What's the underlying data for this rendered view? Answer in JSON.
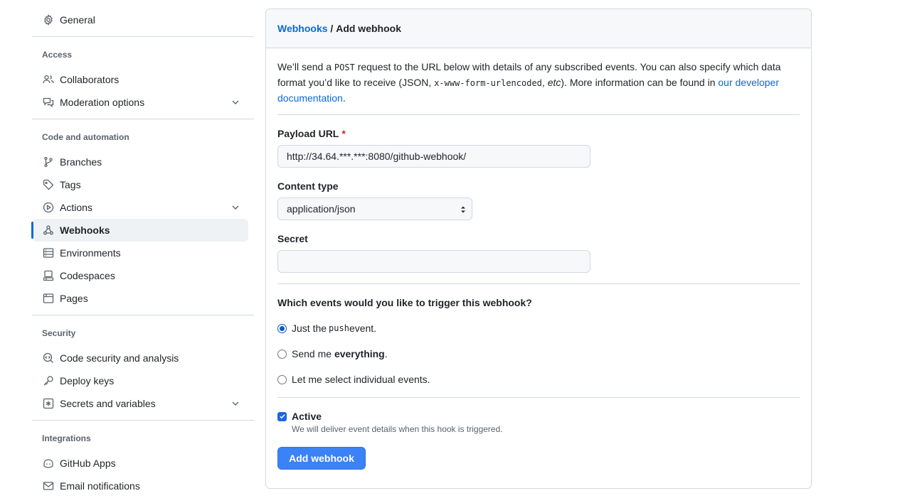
{
  "sidebar": {
    "general": "General",
    "groups": {
      "access": "Access",
      "code_automation": "Code and automation",
      "security": "Security",
      "integrations": "Integrations"
    },
    "items": {
      "collaborators": "Collaborators",
      "moderation": "Moderation options",
      "branches": "Branches",
      "tags": "Tags",
      "actions": "Actions",
      "webhooks": "Webhooks",
      "environments": "Environments",
      "codespaces": "Codespaces",
      "pages": "Pages",
      "code_security": "Code security and analysis",
      "deploy_keys": "Deploy keys",
      "secrets": "Secrets and variables",
      "github_apps": "GitHub Apps",
      "email_notifications": "Email notifications"
    },
    "active_item": "webhooks"
  },
  "breadcrumb": {
    "parent": "Webhooks",
    "separator": " / ",
    "current": "Add webhook"
  },
  "intro": {
    "t1": "We’ll send a ",
    "code1": "POST",
    "t2": " request to the URL below with details of any subscribed events. You can also specify which data format you’d like to receive (JSON, ",
    "code2": "x-www-form-urlencoded",
    "t3": ", ",
    "etc": "etc",
    "t4": "). More information can be found in ",
    "link": "our developer documentation",
    "t5": "."
  },
  "form": {
    "payload_label": "Payload URL",
    "payload_required": "*",
    "payload_value": "http://34.64.***.***:8080/github-webhook/",
    "content_type_label": "Content type",
    "content_type_value": "application/json",
    "secret_label": "Secret",
    "secret_value": "",
    "events_question": "Which events would you like to trigger this webhook?",
    "event_push_pre": "Just the ",
    "event_push_code": "push",
    "event_push_post": " event.",
    "event_everything_pre": "Send me ",
    "event_everything_bold": "everything",
    "event_everything_post": ".",
    "event_individual": "Let me select individual events.",
    "selected_event": "push",
    "active_label": "Active",
    "active_checked": true,
    "active_hint": "We will deliver event details when this hook is triggered.",
    "submit": "Add webhook"
  },
  "colors": {
    "accent": "#0969da",
    "primary_button": "#3b82f6",
    "required": "#d1242f"
  }
}
